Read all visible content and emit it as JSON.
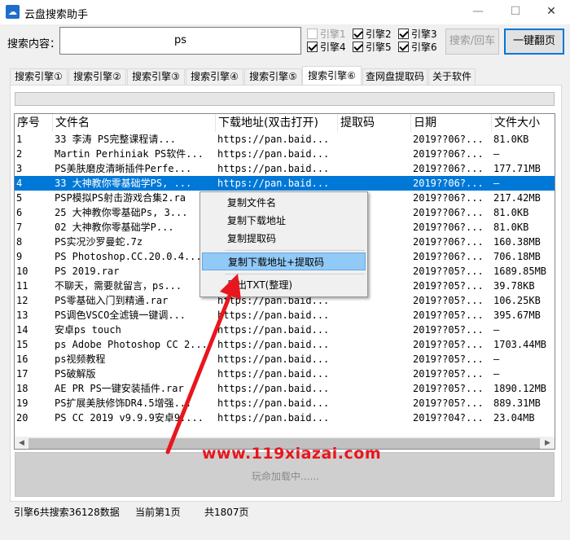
{
  "window": {
    "title": "云盘搜索助手",
    "app_icon": "cloud-icon",
    "minimize_icon": "minimize-icon",
    "maximize_icon": "maximize-icon",
    "close_icon": "close-icon"
  },
  "search": {
    "label": "搜索内容：",
    "value": "ps",
    "search_button": "搜索/回车",
    "page_button": "一键翻页"
  },
  "engines": [
    {
      "label": "引擎1",
      "checked": false,
      "disabled": true
    },
    {
      "label": "引擎2",
      "checked": true,
      "disabled": false
    },
    {
      "label": "引擎3",
      "checked": true,
      "disabled": false
    },
    {
      "label": "引擎4",
      "checked": true,
      "disabled": false
    },
    {
      "label": "引擎5",
      "checked": true,
      "disabled": false
    },
    {
      "label": "引擎6",
      "checked": true,
      "disabled": false
    }
  ],
  "tabs": [
    {
      "label": "搜索引擎①",
      "active": false
    },
    {
      "label": "搜索引擎②",
      "active": false
    },
    {
      "label": "搜索引擎③",
      "active": false
    },
    {
      "label": "搜索引擎④",
      "active": false
    },
    {
      "label": "搜索引擎⑤",
      "active": false
    },
    {
      "label": "搜索引擎⑥",
      "active": true
    },
    {
      "label": "查网盘提取码",
      "active": false
    },
    {
      "label": "关于软件",
      "active": false
    }
  ],
  "table": {
    "headers": [
      "序号",
      "文件名",
      "下载地址(双击打开)",
      "提取码",
      "日期",
      "文件大小"
    ],
    "selected_row": 3,
    "rows": [
      [
        "1",
        "33  李涛  PS完整课程请...",
        "https://pan.baid...",
        "",
        "2019??06?...",
        "81.0KB"
      ],
      [
        "2",
        "Martin Perhiniak PS软件...",
        "https://pan.baid...",
        "",
        "2019??06?...",
        "—"
      ],
      [
        "3",
        "PS美肤磨皮清晰插件Perfe...",
        "https://pan.baid...",
        "",
        "2019??06?...",
        "177.71MB"
      ],
      [
        "4",
        "33 大神教你零基础学PS, ...",
        "https://pan.baid...",
        "",
        "2019??06?...",
        "—"
      ],
      [
        "5",
        "PSP模拟PS射击游戏合集2.ra",
        "",
        "",
        "2019??06?...",
        "217.42MB"
      ],
      [
        "6",
        "25  大神教你零基础Ps, 3...",
        "",
        "",
        "2019??06?...",
        "81.0KB"
      ],
      [
        "7",
        "02    大神教你零基础学P...",
        "",
        "",
        "2019??06?...",
        "81.0KB"
      ],
      [
        "8",
        "PS实况沙罗曼蛇.7z",
        "",
        "",
        "2019??06?...",
        "160.38MB"
      ],
      [
        "9",
        "PS Photoshop.CC.20.0.4...",
        "",
        "",
        "2019??06?...",
        "706.18MB"
      ],
      [
        "10",
        "PS 2019.rar",
        "",
        "",
        "2019??05?...",
        "1689.85MB"
      ],
      [
        "11",
        "不聊天，需要就留言，ps...",
        "",
        "",
        "2019??05?...",
        "39.78KB"
      ],
      [
        "12",
        "PS零基础入门到精通.rar",
        "https://pan.baid...",
        "",
        "2019??05?...",
        "106.25KB"
      ],
      [
        "13",
        "PS调色VSCO全滤镜一键调...",
        "https://pan.baid...",
        "",
        "2019??05?...",
        "395.67MB"
      ],
      [
        "14",
        "安卓ps touch",
        "https://pan.baid...",
        "",
        "2019??05?...",
        "—"
      ],
      [
        "15",
        "ps Adobe Photoshop CC 2...",
        "https://pan.baid...",
        "",
        "2019??05?...",
        "1703.44MB"
      ],
      [
        "16",
        "ps视频教程",
        "https://pan.baid...",
        "",
        "2019??05?...",
        "—"
      ],
      [
        "17",
        "PS破解版",
        "https://pan.baid...",
        "",
        "2019??05?...",
        "—"
      ],
      [
        "18",
        "AE PR PS一键安装插件.rar",
        "https://pan.baid...",
        "",
        "2019??05?...",
        "1890.12MB"
      ],
      [
        "19",
        "PS扩展美肤修饰DR4.5增强...",
        "https://pan.baid...",
        "",
        "2019??05?...",
        "889.31MB"
      ],
      [
        "20",
        "PS CC 2019 v9.9.9安卓9....",
        "https://pan.baid...",
        "",
        "2019??04?...",
        "23.04MB"
      ]
    ]
  },
  "context_menu": {
    "items": [
      "复制文件名",
      "复制下载地址",
      "复制提取码",
      "复制下载地址+提取码",
      "导出TXT(整理)"
    ],
    "highlighted": 3
  },
  "loading_text": "玩命加载中......",
  "status": {
    "engine_info": "引擎6共搜索36128数据",
    "current_page": "当前第1页",
    "total_pages": "共1807页"
  },
  "watermark": "www.119xiazai.com",
  "colors": {
    "selection": "#0078d7",
    "menu_highlight": "#91c9f7",
    "watermark": "#e8161d",
    "arrow": "#e8161d"
  }
}
